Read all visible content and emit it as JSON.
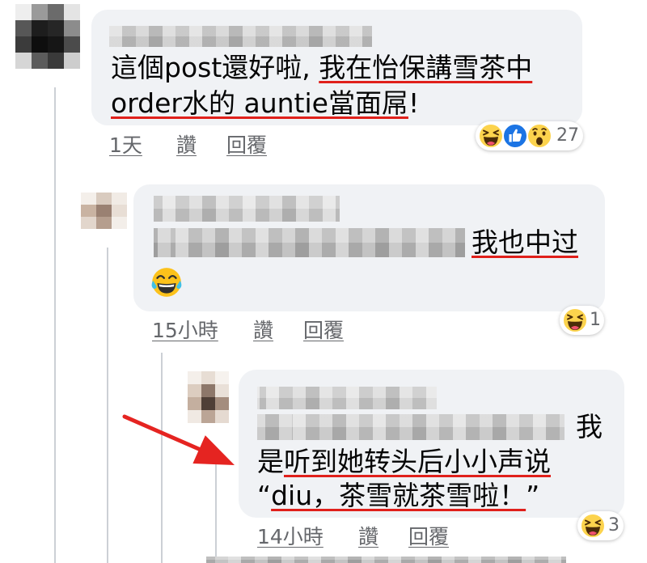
{
  "thread": {
    "comment1": {
      "line1_plain": "這個post還好啦, ",
      "line1_marked": "我在怡保講雪茶中",
      "line2_marked": "order水的 auntie當面屌",
      "line2_plain": "!",
      "reaction_icons": [
        "haha-icon",
        "like-icon",
        "wow-icon"
      ],
      "reaction_count": "27",
      "time": "1天",
      "like_label": "讚",
      "reply_label": "回覆"
    },
    "reply1": {
      "text_marked": "我也中过",
      "emoji": "tears-of-joy-icon",
      "reaction_icons": [
        "haha-icon"
      ],
      "reaction_count": "1",
      "time": "15小時",
      "like_label": "讚",
      "reply_label": "回覆"
    },
    "reply2": {
      "line1_end": "我",
      "line2_plain": "是",
      "line2_marked": "听到她转头后小小声说",
      "line3_open_quote": "“",
      "line3_marked": "diu，茶雪就茶雪啦！",
      "line3_close_quote": "”",
      "reaction_icons": [
        "haha-icon"
      ],
      "reaction_count": "3",
      "time": "14小時",
      "like_label": "讚",
      "reply_label": "回覆"
    }
  },
  "annotation": {
    "arrow_icon": "red-arrow-icon"
  },
  "colors": {
    "bubble": "#f0f2f5",
    "highlight_underline": "#e0201b",
    "arrow": "#e52421",
    "meta_text": "#65676b",
    "thread_line": "#ccd0d5"
  }
}
